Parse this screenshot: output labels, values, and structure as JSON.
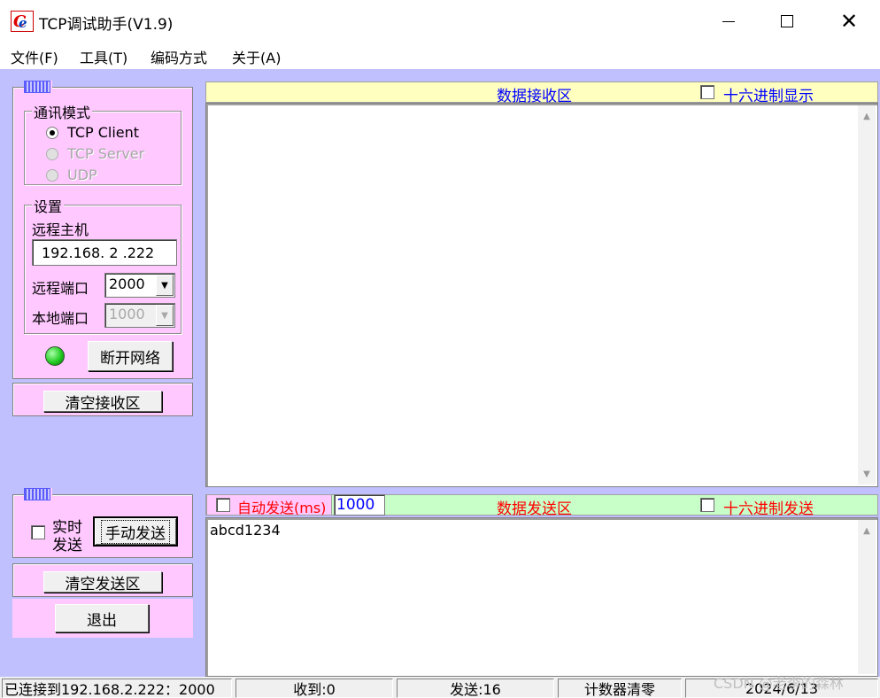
{
  "window": {
    "title": "TCP调试助手(V1.9)",
    "icon": "app-logo-icon",
    "controls": {
      "minimize": "minimize-icon",
      "maximize": "maximize-icon",
      "close": "close-icon"
    }
  },
  "menu": {
    "file": "文件(F)",
    "tools": "工具(T)",
    "encoding": "编码方式",
    "about": "关于(A)"
  },
  "comm_mode": {
    "label": "通讯模式",
    "options": [
      {
        "label": "TCP Client",
        "selected": true,
        "enabled": true
      },
      {
        "label": "TCP Server",
        "selected": false,
        "enabled": false
      },
      {
        "label": "UDP",
        "selected": false,
        "enabled": false
      }
    ]
  },
  "settings": {
    "label": "设置",
    "remote_host_label": "远程主机",
    "remote_host_value": "192.168. 2 .222",
    "remote_port_label": "远程端口",
    "remote_port_value": "2000",
    "local_port_label": "本地端口",
    "local_port_value": "1000"
  },
  "connection": {
    "indicator_color": "#22cc22",
    "disconnect_label": "断开网络"
  },
  "clear_receive_label": "清空接收区",
  "send_panel": {
    "realtime_label_1": "实时",
    "realtime_label_2": "发送",
    "realtime_checked": false,
    "manual_send_label": "手动发送",
    "clear_send_label": "清空发送区",
    "exit_label": "退出"
  },
  "receive_area": {
    "title": "数据接收区",
    "hex_display_label": "十六进制显示",
    "hex_display_checked": false,
    "content": ""
  },
  "send_area": {
    "auto_send_label": "自动发送(ms)",
    "auto_send_checked": false,
    "interval": "1000",
    "title": "数据发送区",
    "hex_send_label": "十六进制发送",
    "hex_send_checked": false,
    "content": "abcd1234"
  },
  "status": {
    "connected": "已连接到192.168.2.222：2000",
    "received": "收到:0",
    "sent": "发送:16",
    "reset_counter": "计数器清零",
    "date": "2024/6/13"
  },
  "watermark": "CSDN @老李的森林",
  "colors": {
    "client_bg": "#c0c0ff",
    "panel_bg": "#ffc8ff",
    "receive_header_bg": "#ffffc0",
    "send_header_bg": "#c8ffc8",
    "receive_title_color": "#0000ff",
    "send_title_color": "#ff0000"
  }
}
